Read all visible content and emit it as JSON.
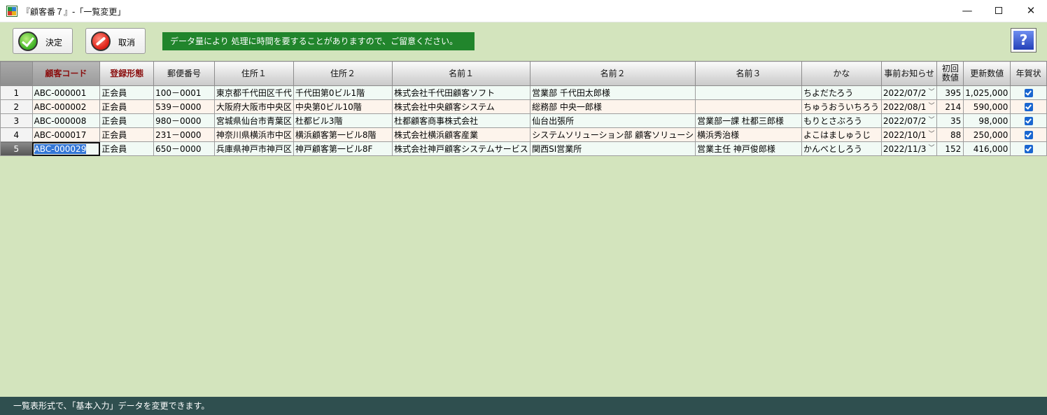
{
  "window": {
    "title": "『顧客番７』-「一覧変更」",
    "minimize_glyph": "—",
    "close_glyph": "✕"
  },
  "toolbar": {
    "ok_label": "決定",
    "cancel_label": "取消",
    "notice": "データ量により 処理に時間を要することがありますので、ご留意ください。",
    "help_glyph": "?"
  },
  "table": {
    "headers": {
      "customer_code": "顧客コード",
      "membership": "登録形態",
      "postal": "郵便番号",
      "address1": "住所１",
      "address2": "住所２",
      "name1": "名前１",
      "name2": "名前２",
      "name3": "名前３",
      "kana": "かな",
      "notice": "事前お知らせ",
      "init_value_line1": "初回",
      "init_value_line2": "数値",
      "update_value": "更新数値",
      "new_year_card": "年賀状"
    },
    "rows": [
      {
        "no": "1",
        "code": "ABC-000001",
        "membership": "正会員",
        "postal": "100－0001",
        "address1": "東京都千代田区千代",
        "address2": "千代田第0ビル1階",
        "name1": "株式会社千代田顧客ソフト",
        "name2": "営業部 千代田太郎様",
        "name3": "",
        "kana": "ちよだたろう",
        "notice": "2022/07/2",
        "init": "395",
        "update": "1,025,000",
        "card": true
      },
      {
        "no": "2",
        "code": "ABC-000002",
        "membership": "正会員",
        "postal": "539－0000",
        "address1": "大阪府大阪市中央区",
        "address2": "中央第0ビル10階",
        "name1": "株式会社中央顧客システム",
        "name2": "総務部 中央一郎様",
        "name3": "",
        "kana": "ちゅうおういちろう",
        "notice": "2022/08/1",
        "init": "214",
        "update": "590,000",
        "card": true
      },
      {
        "no": "3",
        "code": "ABC-000008",
        "membership": "正会員",
        "postal": "980－0000",
        "address1": "宮城県仙台市青葉区",
        "address2": "杜都ビル3階",
        "name1": "杜都顧客商事株式会社",
        "name2": "仙台出張所",
        "name3": "営業部一課 杜都三郎様",
        "kana": "もりとさぶろう",
        "notice": "2022/07/2",
        "init": "35",
        "update": "98,000",
        "card": true
      },
      {
        "no": "4",
        "code": "ABC-000017",
        "membership": "正会員",
        "postal": "231－0000",
        "address1": "神奈川県横浜市中区",
        "address2": "横浜顧客第一ビル8階",
        "name1": "株式会社横浜顧客産業",
        "name2": "システムソリューション部 顧客ソリューシ",
        "name3": "横浜秀治様",
        "kana": "よこはましゅうじ",
        "notice": "2022/10/1",
        "init": "88",
        "update": "250,000",
        "card": true
      },
      {
        "no": "5",
        "code": "ABC-000029",
        "membership": "正会員",
        "postal": "650－0000",
        "address1": "兵庫県神戸市神戸区",
        "address2": "神戸顧客第一ビル8F",
        "name1": "株式会社神戸顧客システムサービス",
        "name2": "関西SI営業所",
        "name3": "営業主任 神戸俊郎様",
        "kana": "かんべとしろう",
        "notice": "2022/11/3",
        "init": "152",
        "update": "416,000",
        "card": true
      }
    ]
  },
  "statusbar": {
    "text": "一覧表形式で、「基本入力」データを変更できます。"
  }
}
